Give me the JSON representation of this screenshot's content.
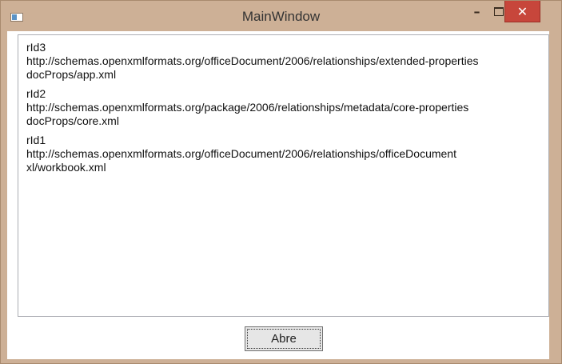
{
  "window": {
    "title": "MainWindow",
    "controls": {
      "minimize_glyph": "–",
      "close_glyph": "✕"
    }
  },
  "list": {
    "entries": [
      {
        "id": "rId3",
        "type": "http://schemas.openxmlformats.org/officeDocument/2006/relationships/extended-properties",
        "target": "docProps/app.xml"
      },
      {
        "id": "rId2",
        "type": "http://schemas.openxmlformats.org/package/2006/relationships/metadata/core-properties",
        "target": "docProps/core.xml"
      },
      {
        "id": "rId1",
        "type": "http://schemas.openxmlformats.org/officeDocument/2006/relationships/officeDocument",
        "target": "xl/workbook.xml"
      }
    ]
  },
  "open_button": {
    "label": "Abre"
  },
  "colors": {
    "frame": "#cdb096",
    "close_button": "#c7463b",
    "list_border": "#abadb3"
  }
}
